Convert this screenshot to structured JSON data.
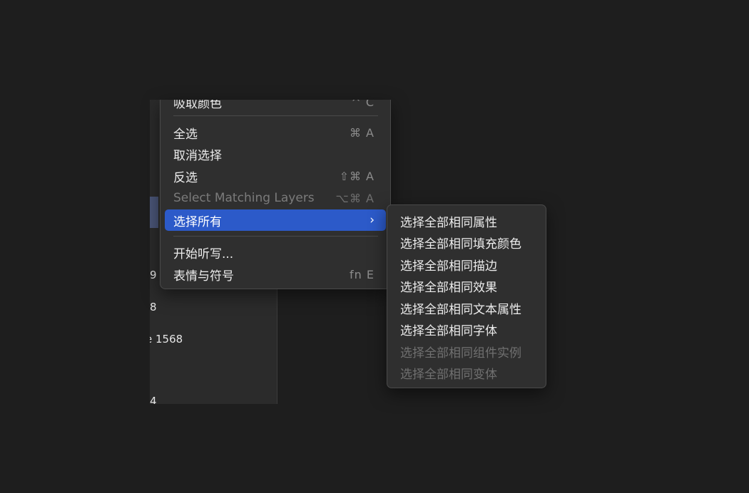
{
  "background_panel": {
    "fragments": [
      "9",
      "8",
      "e 1568",
      "4"
    ]
  },
  "menu": {
    "items": [
      {
        "label": "吸取颜色",
        "shortcut": "^ C"
      },
      {
        "label": "全选",
        "shortcut": "⌘ A"
      },
      {
        "label": "取消选择",
        "shortcut": ""
      },
      {
        "label": "反选",
        "shortcut": "⇧⌘ A"
      },
      {
        "label": "Select Matching Layers",
        "shortcut": "⌥⌘ A"
      },
      {
        "label": "选择所有",
        "submenu_indicator": "›"
      },
      {
        "label": "开始听写...",
        "shortcut": ""
      },
      {
        "label": "表情与符号",
        "shortcut": "fn E"
      }
    ]
  },
  "submenu": {
    "items": [
      {
        "label": "选择全部相同属性"
      },
      {
        "label": "选择全部相同填充颜色"
      },
      {
        "label": "选择全部相同描边"
      },
      {
        "label": "选择全部相同效果"
      },
      {
        "label": "选择全部相同文本属性"
      },
      {
        "label": "选择全部相同字体"
      },
      {
        "label": "选择全部相同组件实例"
      },
      {
        "label": "选择全部相同变体"
      }
    ]
  },
  "colors": {
    "highlight": "#2c5ac9",
    "menu_bg": "#2f2f2f",
    "page_bg": "#1e1e1e"
  }
}
